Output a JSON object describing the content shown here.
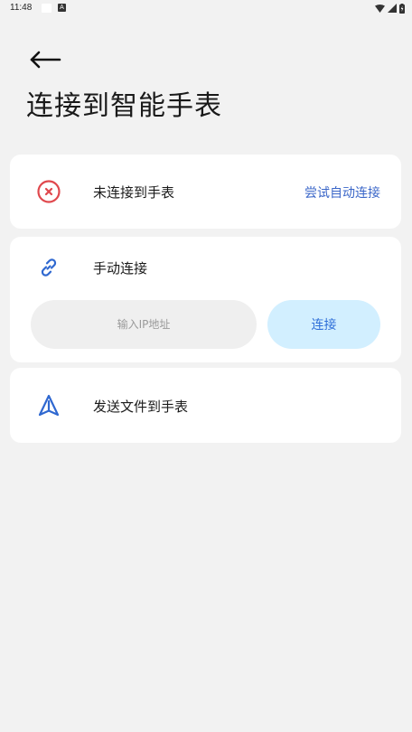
{
  "status_bar": {
    "time": "11:48",
    "badge": "A"
  },
  "header": {
    "title": "连接到智能手表"
  },
  "watch_status": {
    "label": "未连接到手表",
    "retry_label": "尝试自动连接",
    "icon": "disconnected-x-icon",
    "icon_color": "#e0484d"
  },
  "manual_connect": {
    "label": "手动连接",
    "icon": "link-icon",
    "icon_color": "#2f68d0",
    "ip_input": {
      "placeholder": "输入IP地址",
      "value": ""
    },
    "connect_label": "连接"
  },
  "send_file": {
    "label": "发送文件到手表",
    "icon": "send-triangle-icon",
    "icon_color": "#2f68d0"
  },
  "colors": {
    "background": "#f2f2f2",
    "card": "#ffffff",
    "accent_link": "#3a66c8",
    "connect_button_bg": "#d2efff",
    "error": "#e0484d"
  }
}
